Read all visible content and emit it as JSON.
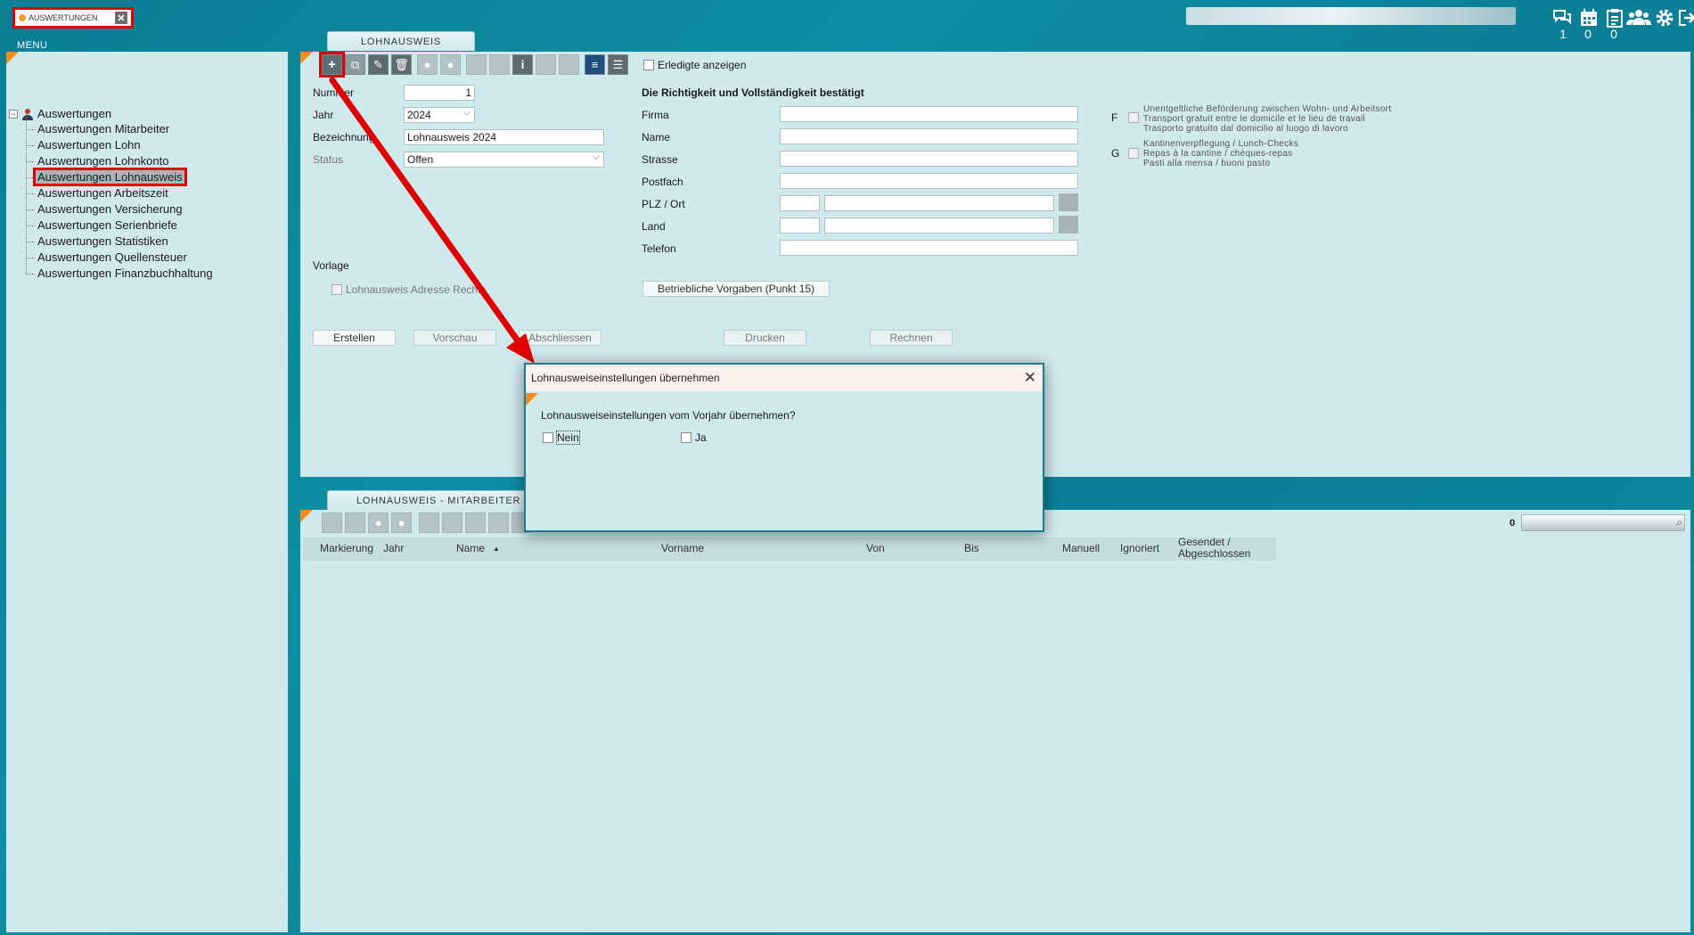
{
  "top": {
    "search_value": "AUSWERTUNGEN",
    "clear_glyph": "✕",
    "counters": [
      "1",
      "0",
      "0"
    ],
    "icons": [
      "chat-icon",
      "calendar-icon",
      "clipboard-icon",
      "group-icon",
      "gear-icon",
      "logout-icon"
    ]
  },
  "menu": {
    "label": "MENU",
    "root": "Auswertungen",
    "items": [
      "Auswertungen Mitarbeiter",
      "Auswertungen Lohn",
      "Auswertungen Lohnkonto",
      "Auswertungen Lohnausweis",
      "Auswertungen Arbeitszeit",
      "Auswertungen Versicherung",
      "Auswertungen Serienbriefe",
      "Auswertungen Statistiken",
      "Auswertungen Quellensteuer",
      "Auswertungen Finanzbuchhaltung"
    ],
    "selected_index": 3
  },
  "form": {
    "tab": "LOHNAUSWEIS",
    "show_done_label": "Erledigte anzeigen",
    "fields": {
      "nummer_label": "Nummer",
      "nummer_value": "1",
      "jahr_label": "Jahr",
      "jahr_value": "2024",
      "bezeichnung_label": "Bezeichnung",
      "bezeichnung_value": "Lohnausweis 2024",
      "status_label": "Status",
      "status_value": "Offen"
    },
    "vorlage_label": "Vorlage",
    "adresse_rechts_label": "Lohnausweis Adresse Rechts",
    "confirm_heading": "Die Richtigkeit und Vollständigkeit bestätigt",
    "address_labels": [
      "Firma",
      "Name",
      "Strasse",
      "Postfach",
      "PLZ / Ort",
      "Land",
      "Telefon"
    ],
    "f_letter": "F",
    "f_text": [
      "Unentgeltliche Beförderung zwischen Wohn- und Arbeitsort",
      "Transport gratuit entre le domicile et le lieu de travail",
      "Trasporto gratuito dal domicilio al luogo di lavoro"
    ],
    "g_letter": "G",
    "g_text": [
      "Kantinenverpflegung / Lunch-Checks",
      "Repas à la cantine / chèques-repas",
      "Pasti alla mensa / buoni pasto"
    ],
    "betriebliche_button": "Betriebliche Vorgaben (Punkt 15)",
    "actions": {
      "erstellen": "Erstellen",
      "vorschau": "Vorschau",
      "abschliessen": "Abschliessen",
      "drucken": "Drucken",
      "rechnen": "Rechnen"
    }
  },
  "list": {
    "tab": "LOHNAUSWEIS - MITARBEITER ÜBERSICHT",
    "count": "0",
    "columns": [
      "Markierung",
      "Jahr",
      "Name",
      "Vorname",
      "Von",
      "Bis",
      "Manuell",
      "Ignoriert",
      "Gesendet /",
      "Abgeschlossen"
    ],
    "sort_glyph": "▲"
  },
  "modal": {
    "title": "Lohnausweiseinstellungen übernehmen",
    "question": "Lohnausweiseinstellungen vom Vorjahr übernehmen?",
    "option_no": "Nein",
    "option_yes": "Ja",
    "close_glyph": "✕"
  },
  "colors": {
    "annotation_red": "#e00000",
    "accent_orange": "#f08c1e",
    "panel_bg": "#cfe9ed",
    "page_bg": "#0a7e93"
  }
}
